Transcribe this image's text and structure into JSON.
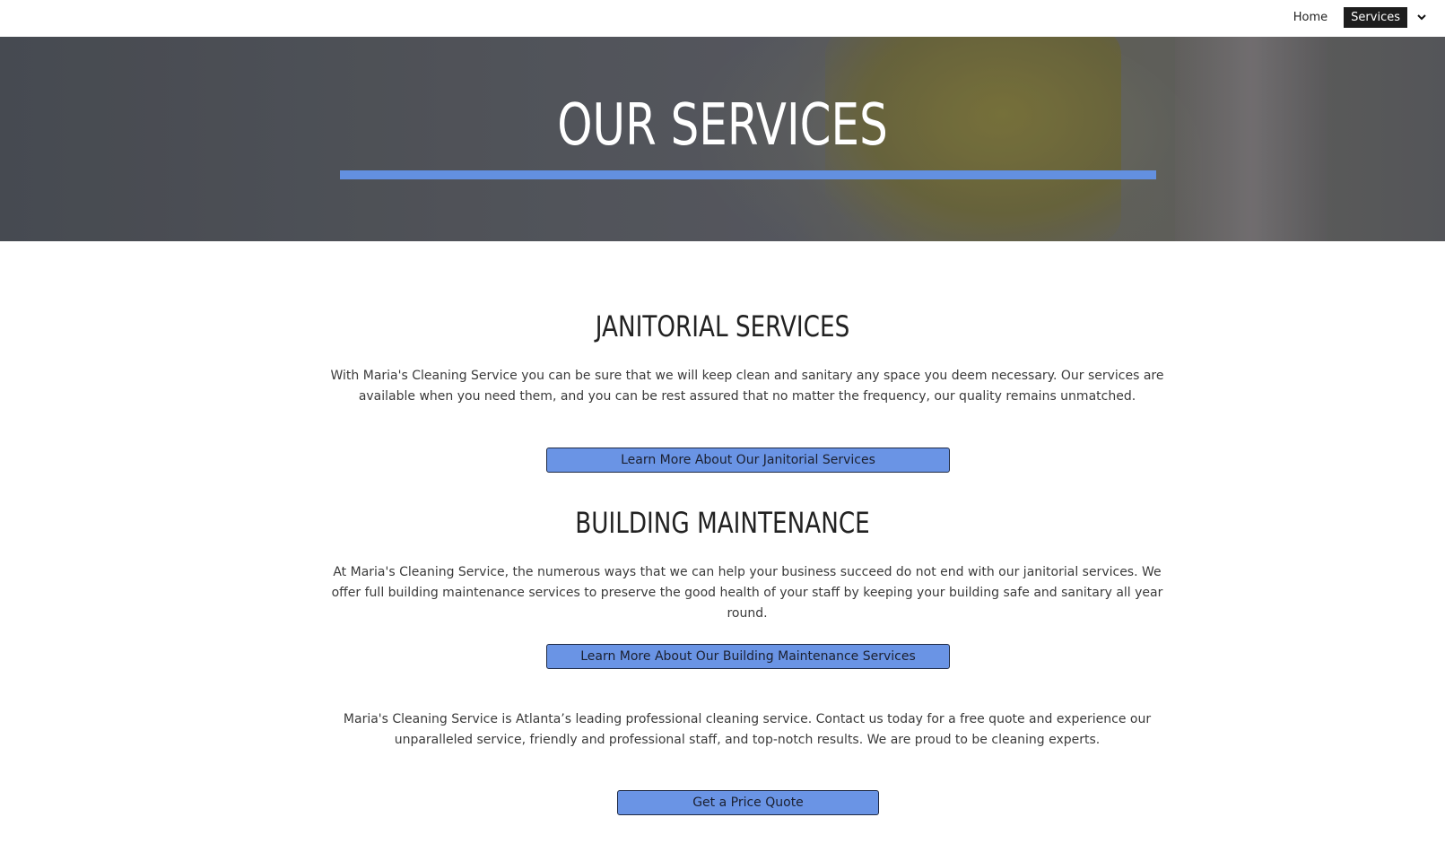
{
  "nav": {
    "items": [
      {
        "label": "Home"
      },
      {
        "label": "Services"
      }
    ]
  },
  "hero": {
    "title": "OUR SERVICES"
  },
  "sections": [
    {
      "heading": "JANITORIAL SERVICES",
      "body": "With Maria's Cleaning Service you can be sure that we will keep clean and sanitary any space you deem necessary. Our services are available when you need them, and you can be rest assured that no matter the frequency, our quality remains unmatched.",
      "button": "Learn More About Our Janitorial Services"
    },
    {
      "heading": "BUILDING MAINTENANCE",
      "body": "At Maria's Cleaning Service, the numerous ways that we can help your business succeed do not end with our janitorial services. We offer full building maintenance services to preserve the good health of your staff by keeping your building safe and sanitary all year round.",
      "button": "Learn More About Our Building Maintenance Services"
    }
  ],
  "closing": {
    "body": "Maria's Cleaning Service  is Atlanta’s leading professional cleaning service. Contact us today for a free quote and experience our unparalleled service, friendly and professional staff, and top-notch results. We are proud to be cleaning experts.",
    "button": "Get a Price Quote"
  },
  "colors": {
    "accent": "#6390e0",
    "button_bg": "#6a94e5",
    "nav_active_bg": "#1d1d1d"
  }
}
